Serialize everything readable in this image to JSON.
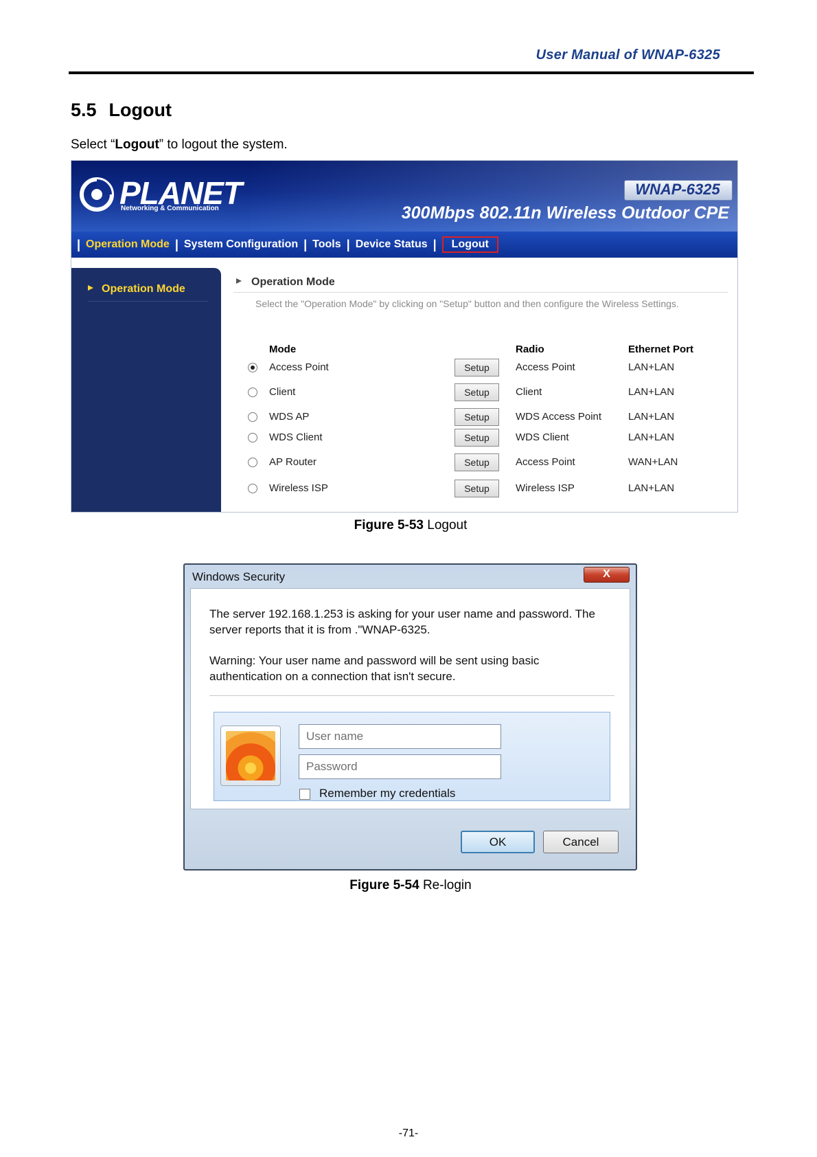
{
  "header": {
    "running_head": "User Manual of WNAP-6325"
  },
  "section": {
    "number": "5.5",
    "title": "Logout",
    "intro_pre": "Select “",
    "intro_bold": "Logout",
    "intro_post": "” to logout the system."
  },
  "router_ui": {
    "logo": "PLANET",
    "logo_sub": "Networking & Communication",
    "model": "WNAP-6325",
    "product": "300Mbps 802.11n Wireless Outdoor CPE",
    "nav": [
      "Operation Mode",
      "System Configuration",
      "Tools",
      "Device Status",
      "Logout"
    ],
    "sidebar_item": "Operation Mode",
    "content_title": "Operation Mode",
    "content_desc": "Select the \"Operation Mode\" by clicking on \"Setup\" button and then configure the Wireless Settings.",
    "table": {
      "headers": {
        "mode": "Mode",
        "radio": "Radio",
        "ethernet": "Ethernet Port"
      },
      "setup_label": "Setup",
      "rows": [
        {
          "mode": "Access Point",
          "radio": "Access Point",
          "ethernet": "LAN+LAN",
          "selected": true
        },
        {
          "mode": "Client",
          "radio": "Client",
          "ethernet": "LAN+LAN",
          "selected": false
        },
        {
          "mode": "WDS AP",
          "radio": "WDS Access Point",
          "ethernet": "LAN+LAN",
          "selected": false
        },
        {
          "mode": "WDS Client",
          "radio": "WDS Client",
          "ethernet": "LAN+LAN",
          "selected": false
        },
        {
          "mode": "AP Router",
          "radio": "Access Point",
          "ethernet": "WAN+LAN",
          "selected": false
        },
        {
          "mode": "Wireless ISP",
          "radio": "Wireless ISP",
          "ethernet": "LAN+LAN",
          "selected": false
        }
      ]
    },
    "colors": {
      "banner": "#0f2c8a",
      "active_nav": "#ffd630",
      "logout_highlight": "#e02020"
    }
  },
  "figure1_caption": {
    "label": "Figure 5-53",
    "text": "Logout"
  },
  "dialog": {
    "title": "Windows Security",
    "close": "X",
    "message_line1": "The server 192.168.1.253 is asking for your user name and password. The",
    "message_line2": "server reports that it is from .\"WNAP-6325.",
    "warning_line1": "Warning: Your user name and password will be sent using basic",
    "warning_line2": "authentication on a connection that isn't secure.",
    "username_placeholder": "User name",
    "password_placeholder": "Password",
    "remember_label": "Remember my credentials",
    "ok_label": "OK",
    "cancel_label": "Cancel"
  },
  "figure2_caption": {
    "label": "Figure 5-54",
    "text": "Re-login"
  },
  "page_number": "-71-"
}
